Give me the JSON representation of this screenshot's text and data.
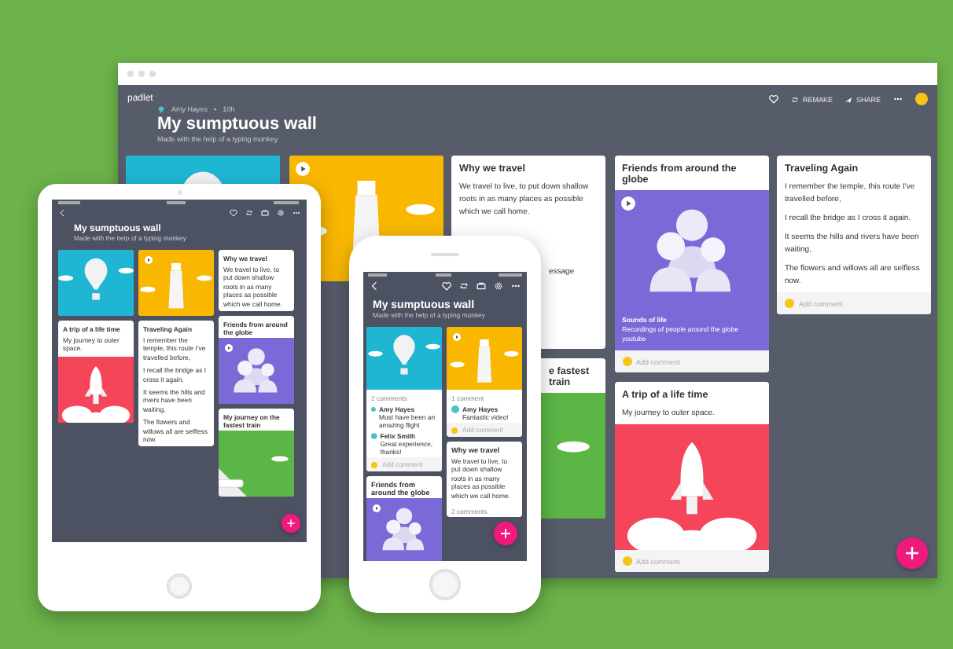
{
  "browser": {
    "logo": "padlet",
    "author": "Amy Hayes",
    "separator": "•",
    "age": "10h",
    "title": "My sumptuous wall",
    "subtitle": "Made with the help of a typing monkey",
    "actions": [
      {
        "kind": "remake",
        "label": "REMAKE"
      },
      {
        "kind": "share",
        "label": "SHARE"
      }
    ],
    "columns": [
      [
        {
          "media": {
            "kind": "balloon"
          }
        }
      ],
      [
        {
          "media": {
            "kind": "lighthouse",
            "playable": true
          }
        }
      ],
      [
        {
          "title": "Why we travel",
          "body": [
            "We travel to live, to put down shallow roots in as many places as possible which we call home."
          ],
          "partial_text": "essage"
        },
        {
          "partial_title": "e fastest train",
          "media": {
            "kind": "train"
          }
        }
      ],
      [
        {
          "title": "Friends from around the globe",
          "media": {
            "kind": "people",
            "playable": true,
            "caption": {
              "title": "Sounds of life",
              "text": "Recordings of people around the globe",
              "source": "youtube"
            }
          },
          "footer": "Add comment"
        },
        {
          "title": "A trip of a life time",
          "body": [
            "My journey to outer space."
          ],
          "media": {
            "kind": "rocket"
          },
          "footer": "Add comment"
        }
      ],
      [
        {
          "title": "Traveling Again",
          "body": [
            "I remember the temple, this route I've travelled before,",
            "I recall the bridge as I cross it again.",
            "It seems the hills and rivers have been waiting,",
            "The flowers and willows all are selfless now."
          ],
          "footer": "Add comment"
        }
      ]
    ]
  },
  "tablet": {
    "title": "My sumptuous wall",
    "subtitle": "Made with the help of a typing monkey",
    "columns": [
      [
        {
          "media": {
            "kind": "balloon"
          }
        },
        {
          "title": "A trip of a life time",
          "body": [
            "My journey to outer space."
          ],
          "media": {
            "kind": "rocket"
          }
        }
      ],
      [
        {
          "media": {
            "kind": "lighthouse",
            "playable": true
          }
        },
        {
          "title": "Traveling Again",
          "body": [
            "I remember the temple, this route I've travelled before,",
            "I recall the bridge as I cross it again.",
            "It seems the hills and rivers have been waiting,",
            "The flowers and willows all are selfless now."
          ]
        }
      ],
      [
        {
          "title": "Why we travel",
          "body": [
            "We travel to live, to put down shallow roots in as many places as possible which we call home."
          ]
        },
        {
          "title": "Friends from around the globe",
          "media": {
            "kind": "people",
            "playable": true
          }
        },
        {
          "title": "My journey on the fastest train",
          "media": {
            "kind": "train"
          }
        }
      ]
    ]
  },
  "phone": {
    "title": "My sumptuous wall",
    "subtitle": "Made with the help of a typing monkey",
    "columns": [
      [
        {
          "media": {
            "kind": "balloon"
          },
          "comment_count": "2 comments",
          "comments": [
            {
              "author": "Amy Hayes",
              "text": "Must have been an amazing flight"
            },
            {
              "author": "Felix Smith",
              "text": "Great experience, thanks!"
            }
          ],
          "footer": "Add comment"
        },
        {
          "title": "Friends from around the globe",
          "media": {
            "kind": "people",
            "playable": true
          }
        }
      ],
      [
        {
          "media": {
            "kind": "lighthouse",
            "playable": true
          },
          "comment_count": "1 comment",
          "comments": [
            {
              "author": "Amy Hayes",
              "text": "Fantastic video!"
            }
          ],
          "footer": "Add comment"
        },
        {
          "title": "Why we travel",
          "body": [
            "We travel to live, to put down shallow roots in as many places as possible which we call home."
          ],
          "comment_count": "2 comments"
        }
      ]
    ]
  }
}
